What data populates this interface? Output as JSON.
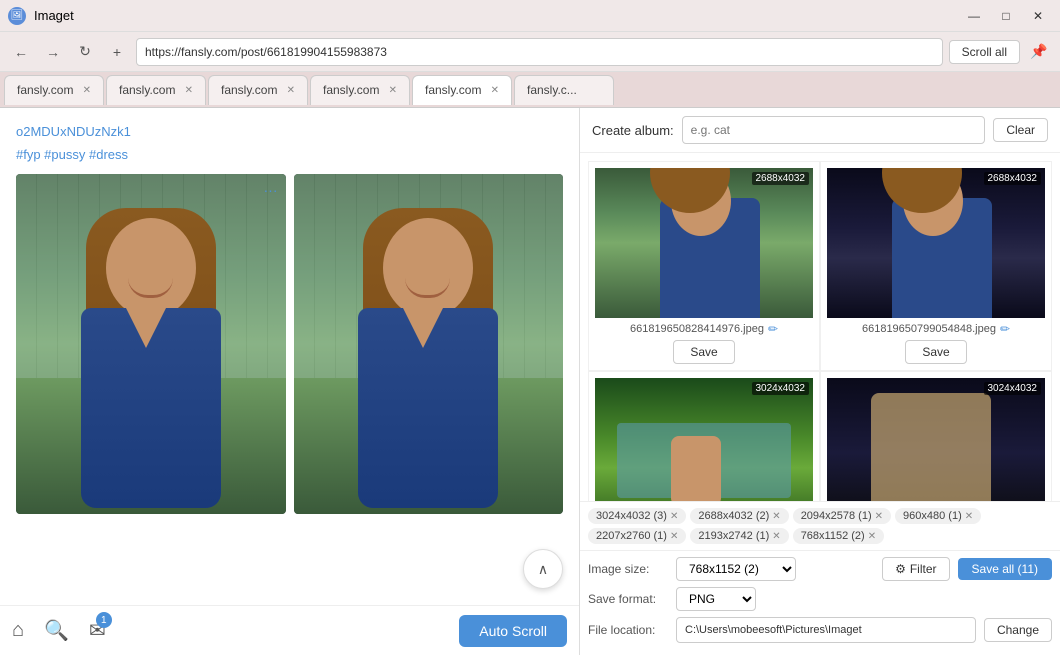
{
  "app": {
    "title": "Imaget",
    "icon": "🖼"
  },
  "title_bar": {
    "minimize": "—",
    "maximize": "□",
    "close": "✕"
  },
  "nav": {
    "back": "←",
    "forward": "→",
    "refresh": "↻",
    "new_tab": "+",
    "address": "https://fansly.com/post/661819904155983873",
    "scroll_all": "Scroll all",
    "pin": "📌"
  },
  "tabs": [
    {
      "label": "fansly.com",
      "active": false
    },
    {
      "label": "fansly.com",
      "active": false
    },
    {
      "label": "fansly.com",
      "active": false
    },
    {
      "label": "fansly.com",
      "active": false
    },
    {
      "label": "fansly.com",
      "active": true
    },
    {
      "label": "fansly.c...",
      "active": false
    }
  ],
  "browser": {
    "page_link": "o2MDUxNDUzNzk1",
    "hashtags": "#fyp #pussy #dress",
    "more_dots": "···",
    "scroll_up": "∧"
  },
  "bottom_bar": {
    "home": "⌂",
    "search": "🔍",
    "messages": "✉",
    "badge": "1",
    "auto_scroll": "Auto Scroll"
  },
  "right_panel": {
    "create_album_label": "Create album:",
    "album_placeholder": "e.g. cat",
    "clear_btn": "Clear",
    "images": [
      {
        "dims": "2688x4032",
        "filename": "661819650828414976.jpeg",
        "save": "Save",
        "thumb_class": "image-thumb-1"
      },
      {
        "dims": "2688x4032",
        "filename": "661819650799054848.jpeg",
        "save": "Save",
        "thumb_class": "image-thumb-2"
      },
      {
        "dims": "3024x4032",
        "filename": "",
        "save": "",
        "thumb_class": "image-thumb-3"
      },
      {
        "dims": "3024x4032",
        "filename": "",
        "save": "",
        "thumb_class": "image-thumb-4"
      }
    ],
    "filter_tags": [
      {
        "label": "3024x4032 (3)"
      },
      {
        "label": "2688x4032 (2)"
      },
      {
        "label": "2094x2578 (1)"
      },
      {
        "label": "960x480 (1)"
      },
      {
        "label": "2207x2760 (1)"
      },
      {
        "label": "2193x2742 (1)"
      },
      {
        "label": "768x1152 (2)"
      }
    ],
    "image_size_label": "Image size:",
    "image_size_value": "768x1152 (2)",
    "filter_btn": "Filter",
    "save_all_btn": "Save all (11)",
    "save_format_label": "Save format:",
    "format_value": "PNG",
    "file_location_label": "File location:",
    "file_path": "C:\\Users\\mobeesoft\\Pictures\\Imaget",
    "change_btn": "Change"
  }
}
